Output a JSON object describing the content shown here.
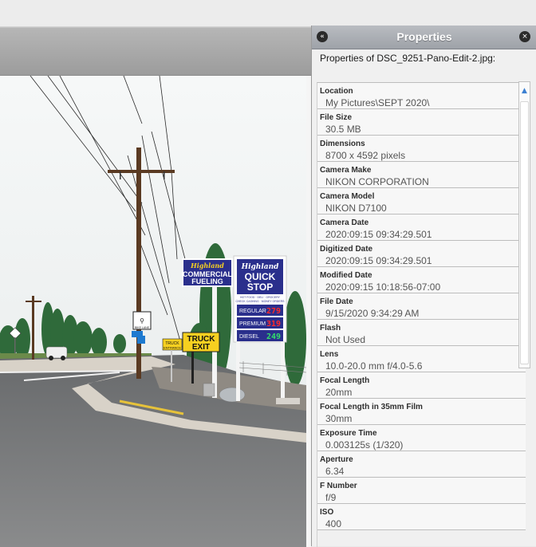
{
  "panel": {
    "title": "Properties",
    "subtitle": "Properties of DSC_9251-Pano-Edit-2.jpg:"
  },
  "properties": [
    {
      "label": "Location",
      "value": "My Pictures\\SEPT 2020\\"
    },
    {
      "label": "File Size",
      "value": "30.5 MB"
    },
    {
      "label": "Dimensions",
      "value": "8700 x 4592 pixels"
    },
    {
      "label": "Camera Make",
      "value": "NIKON CORPORATION"
    },
    {
      "label": "Camera Model",
      "value": "NIKON D7100"
    },
    {
      "label": "Camera Date",
      "value": "2020:09:15 09:34:29.501"
    },
    {
      "label": "Digitized Date",
      "value": "2020:09:15 09:34:29.501"
    },
    {
      "label": "Modified Date",
      "value": "2020:09:15 10:18:56-07:00"
    },
    {
      "label": "File Date",
      "value": "9/15/2020 9:34:29 AM"
    },
    {
      "label": "Flash",
      "value": "Not Used"
    },
    {
      "label": "Lens",
      "value": "10.0-20.0 mm f/4.0-5.6"
    },
    {
      "label": "Focal Length",
      "value": "20mm"
    },
    {
      "label": "Focal Length in 35mm Film",
      "value": "30mm"
    },
    {
      "label": "Exposure Time",
      "value": "0.003125s (1/320)"
    },
    {
      "label": "Aperture",
      "value": "6.34"
    },
    {
      "label": "F Number",
      "value": "f/9"
    },
    {
      "label": "ISO",
      "value": "400"
    }
  ],
  "photo_signs": {
    "highland_script_1": "Highland",
    "commercial_fueling_1": "COMMERCIAL",
    "commercial_fueling_2": "FUELING",
    "highland_script_2": "Highland",
    "quick": "QUICK",
    "stop": "STOP",
    "tagline_1": "HOT FOOD · DELI · GROCERY",
    "tagline_2": "CHECK CASHING · MONEY ORDERS",
    "regular": "REGULAR",
    "regular_price": "279",
    "premium": "PREMIUM",
    "premium_price": "319",
    "diesel": "DIESEL",
    "diesel_price": "249",
    "truck": "TRUCK",
    "exit": "EXIT",
    "truck_entrance_1": "TRUCK",
    "truck_entrance_2": "ENTRANCE",
    "bike_lane": "BIKE LANE"
  },
  "icons": {
    "collapse": "«",
    "close": "×",
    "scroll_up": "▲"
  },
  "colors": {
    "header_bg": "#a9adb3",
    "panel_bg": "#f0f0f0",
    "row_bg": "#f7f7f7",
    "scroll_arrow": "#3b7fd1",
    "sign_blue": "#2a2f8c",
    "price_red": "#ff2a2a",
    "price_green": "#33e06a",
    "truck_exit_yellow": "#f6d020"
  }
}
